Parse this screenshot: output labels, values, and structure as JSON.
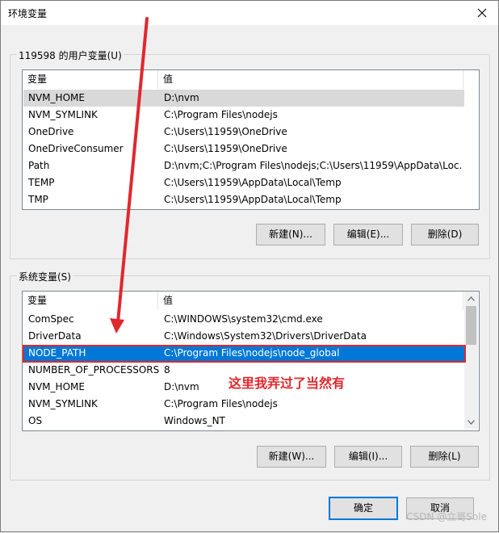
{
  "window": {
    "title": "环境变量"
  },
  "user_vars": {
    "group_label": "119598 的用户变量(U)",
    "columns": [
      "变量",
      "值"
    ],
    "rows": [
      {
        "name": "NVM_HOME",
        "value": "D:\\nvm"
      },
      {
        "name": "NVM_SYMLINK",
        "value": "C:\\Program Files\\nodejs"
      },
      {
        "name": "OneDrive",
        "value": "C:\\Users\\11959\\OneDrive"
      },
      {
        "name": "OneDriveConsumer",
        "value": "C:\\Users\\11959\\OneDrive"
      },
      {
        "name": "Path",
        "value": "D:\\nvm;C:\\Program Files\\nodejs;C:\\Users\\11959\\AppData\\Loc..."
      },
      {
        "name": "TEMP",
        "value": "C:\\Users\\11959\\AppData\\Local\\Temp"
      },
      {
        "name": "TMP",
        "value": "C:\\Users\\11959\\AppData\\Local\\Temp"
      }
    ],
    "buttons": {
      "new": "新建(N)...",
      "edit": "编辑(E)...",
      "delete": "删除(D)"
    }
  },
  "system_vars": {
    "group_label": "系统变量(S)",
    "columns": [
      "变量",
      "值"
    ],
    "rows": [
      {
        "name": "ComSpec",
        "value": "C:\\WINDOWS\\system32\\cmd.exe"
      },
      {
        "name": "DriverData",
        "value": "C:\\Windows\\System32\\Drivers\\DriverData"
      },
      {
        "name": "NODE_PATH",
        "value": "C:\\Program Files\\nodejs\\node_global"
      },
      {
        "name": "NUMBER_OF_PROCESSORS",
        "value": "8"
      },
      {
        "name": "NVM_HOME",
        "value": "D:\\nvm"
      },
      {
        "name": "NVM_SYMLINK",
        "value": "C:\\Program Files\\nodejs"
      },
      {
        "name": "OS",
        "value": "Windows_NT"
      }
    ],
    "buttons": {
      "new": "新建(W)...",
      "edit": "编辑(I)...",
      "delete": "删除(L)"
    }
  },
  "footer": {
    "ok": "确定",
    "cancel": "取消"
  },
  "annotation": {
    "text": "这里我弄过了当然有",
    "color": "#e0282e"
  },
  "watermark": "CSDN @立哥Sole",
  "colors": {
    "selection": "#0078d7",
    "annotation": "#e0282e",
    "hover_row": "#d9d9d9"
  }
}
